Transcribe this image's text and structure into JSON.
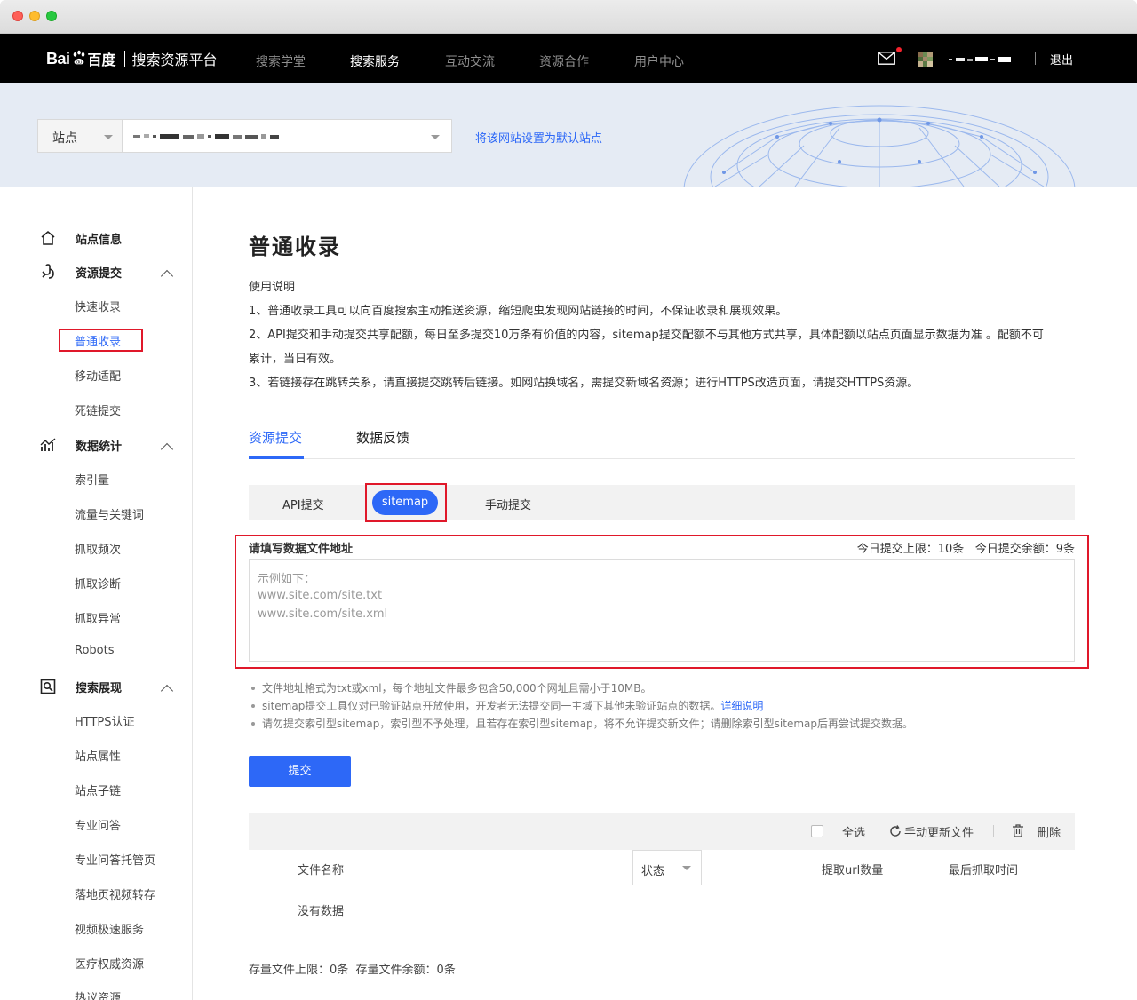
{
  "brand": {
    "logo_bai": "Bai",
    "logo_cn": "百度",
    "platform": "搜索资源平台"
  },
  "topnav": {
    "items": [
      {
        "label": "搜索学堂"
      },
      {
        "label": "搜索服务"
      },
      {
        "label": "互动交流"
      },
      {
        "label": "资源合作"
      },
      {
        "label": "用户中心"
      }
    ],
    "active_index": 1,
    "logout": "退出"
  },
  "site_selector": {
    "label": "站点",
    "set_default": "将该网站设置为默认站点"
  },
  "sidebar": {
    "groups": [
      {
        "label": "站点信息",
        "icon": "home-icon"
      },
      {
        "label": "资源提交",
        "icon": "submit-icon",
        "items": [
          "快速收录",
          "普通收录",
          "移动适配",
          "死链提交"
        ]
      },
      {
        "label": "数据统计",
        "icon": "chart-icon",
        "items": [
          "索引量",
          "流量与关键词",
          "抓取频次",
          "抓取诊断",
          "抓取异常",
          "Robots"
        ]
      },
      {
        "label": "搜索展现",
        "icon": "search-display-icon",
        "items": [
          "HTTPS认证",
          "站点属性",
          "站点子链",
          "专业问答",
          "专业问答托管页",
          "落地页视频转存",
          "视频极速服务",
          "医疗权威资源",
          "热议资源"
        ]
      }
    ],
    "active_item": "普通收录"
  },
  "main": {
    "title": "普通收录",
    "desc": [
      "使用说明",
      "1、普通收录工具可以向百度搜索主动推送资源，缩短爬虫发现网站链接的时间，不保证收录和展现效果。",
      "2、API提交和手动提交共享配额，每日至多提交10万条有价值的内容，sitemap提交配额不与其他方式共享，具体配额以站点页面显示数据为准 。配额不可",
      "累计，当日有效。",
      "3、若链接存在跳转关系，请直接提交跳转后链接。如网站换域名，需提交新域名资源；进行HTTPS改造页面，请提交HTTPS资源。"
    ],
    "tabs": [
      {
        "label": "资源提交"
      },
      {
        "label": "数据反馈"
      }
    ],
    "subtabs": {
      "api": "API提交",
      "sitemap": "sitemap",
      "manual": "手动提交"
    },
    "form": {
      "label": "请填写数据文件地址",
      "limit": "今日提交上限：10条",
      "remaining": "今日提交余额：9条",
      "placeholder_lines": [
        "示例如下：",
        "www.site.com/site.txt",
        "www.site.com/site.xml"
      ]
    },
    "tips": [
      "文件地址格式为txt或xml，每个地址文件最多包含50,000个网址且需小于10MB。",
      "sitemap提交工具仅对已验证站点开放使用，开发者无法提交同一主域下其他未验证站点的数据。",
      "请勿提交索引型sitemap，索引型不予处理，且若存在索引型sitemap，将不允许提交新文件；请删除索引型sitemap后再尝试提交数据。"
    ],
    "tip_link": "详细说明",
    "submit": "提交",
    "table": {
      "select_all": "全选",
      "refresh": "手动更新文件",
      "delete": "删除",
      "columns": {
        "name": "文件名称",
        "status": "状态",
        "count": "提取url数量",
        "last_crawl": "最后抓取时间"
      },
      "empty": "没有数据"
    },
    "storage": {
      "limit": "存量文件上限：0条",
      "remaining": "存量文件余额：0条"
    }
  },
  "colors": {
    "accent": "#2d68f7",
    "highlight": "#e0182a",
    "topbar": "#000000"
  }
}
